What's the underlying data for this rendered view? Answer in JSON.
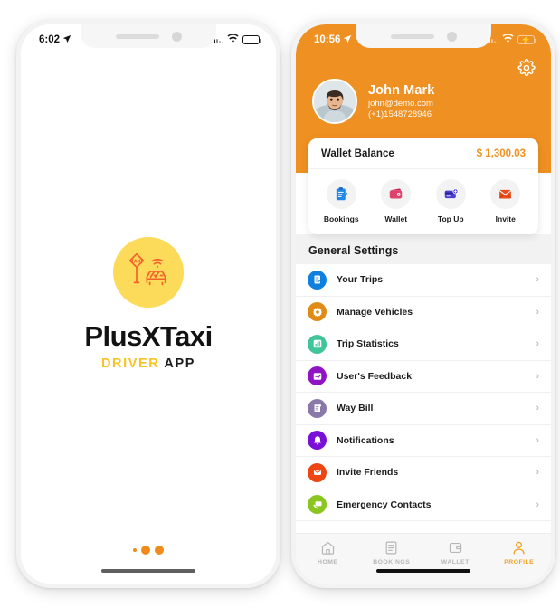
{
  "left_phone": {
    "status_bar": {
      "time": "6:02",
      "location_icon": "location-arrow-icon",
      "signal_icon": "cellular-signal-icon",
      "wifi_icon": "wifi-icon",
      "battery_icon": "battery-icon"
    },
    "splash": {
      "logo_icon": "taxi-sign-wifi-car-logo-icon",
      "logo_bg_color": "#fbdb59",
      "logo_stroke_color": "#f4622c",
      "app_title": "PlusXTaxi",
      "subtitle_primary": "DRIVER",
      "subtitle_secondary": "APP",
      "subtitle_primary_color": "#f7c325",
      "page_dots": [
        "small",
        "large",
        "large"
      ],
      "page_dot_color": "#f08a1a"
    }
  },
  "right_phone": {
    "status_bar": {
      "time": "10:56",
      "location_icon": "location-arrow-icon",
      "signal_icon": "cellular-signal-icon",
      "wifi_icon": "wifi-icon",
      "battery_icon": "battery-charging-icon",
      "battery_color": "#3ccf4e"
    },
    "header": {
      "background_color": "#ef9022",
      "settings_icon": "gear-icon",
      "avatar_icon": "user-photo-avatar",
      "name": "John Mark",
      "email": "john@demo.com",
      "phone": "(+1)1548728946"
    },
    "wallet_card": {
      "label": "Wallet Balance",
      "amount": "$ 1,300.03",
      "amount_color": "#ef9022",
      "quick_actions": [
        {
          "label": "Bookings",
          "icon": "clipboard-checklist-icon",
          "color": "#1e88e5"
        },
        {
          "label": "Wallet",
          "icon": "wallet-icon",
          "color": "#e0426b"
        },
        {
          "label": "Top Up",
          "icon": "card-plus-icon",
          "color": "#4a3fd4"
        },
        {
          "label": "Invite",
          "icon": "envelope-icon",
          "color": "#ec4a19"
        }
      ]
    },
    "settings": {
      "section_title": "General Settings",
      "items": [
        {
          "label": "Your Trips",
          "icon": "trip-note-icon",
          "color": "#0f7fe0",
          "chevron": "›"
        },
        {
          "label": "Manage Vehicles",
          "icon": "gear-vehicle-icon",
          "color": "#e08b15",
          "chevron": "›"
        },
        {
          "label": "Trip Statistics",
          "icon": "bar-chart-icon",
          "color": "#40c49a",
          "chevron": "›"
        },
        {
          "label": "User's Feedback",
          "icon": "feedback-note-icon",
          "color": "#9013c4",
          "chevron": "›"
        },
        {
          "label": "Way Bill",
          "icon": "waybill-scroll-icon",
          "color": "#8a78a8",
          "chevron": "›"
        },
        {
          "label": "Notifications",
          "icon": "bell-icon",
          "color": "#7a0fd8",
          "chevron": "›"
        },
        {
          "label": "Invite Friends",
          "icon": "mail-invite-icon",
          "color": "#ee4512",
          "chevron": "›"
        },
        {
          "label": "Emergency Contacts",
          "icon": "phone-chat-icon",
          "color": "#8bc520",
          "chevron": "›"
        }
      ]
    },
    "tabbar": {
      "active_color": "#f2a01f",
      "inactive_color": "#b6b6b6",
      "tabs": [
        {
          "label": "HOME",
          "icon": "home-icon",
          "active": false
        },
        {
          "label": "BOOKINGS",
          "icon": "list-icon",
          "active": false
        },
        {
          "label": "WALLET",
          "icon": "wallet-icon",
          "active": false
        },
        {
          "label": "PROFILE",
          "icon": "person-icon",
          "active": true
        }
      ]
    }
  }
}
